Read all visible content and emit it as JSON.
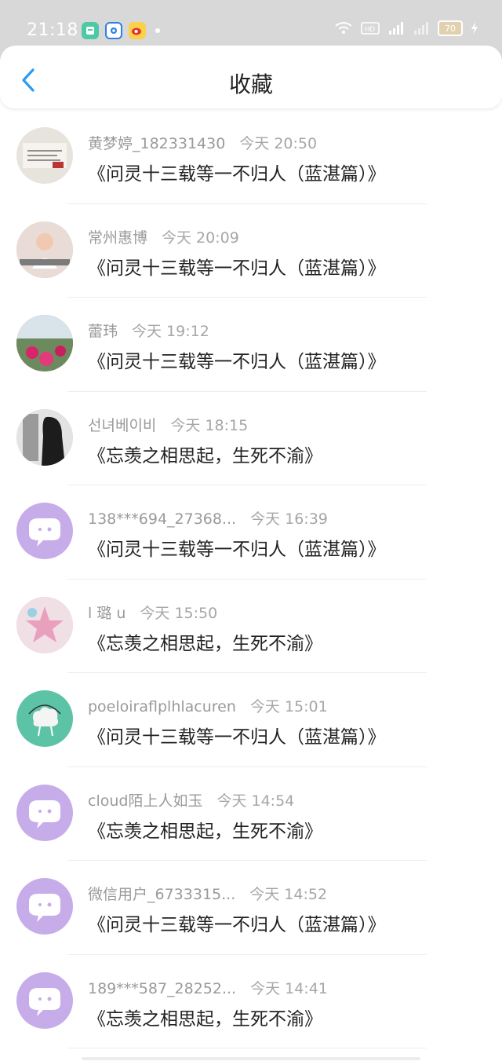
{
  "status_bar": {
    "time": "21:18",
    "icons": [
      "notification-app-icon",
      "browser-app-icon",
      "weibo-icon",
      "dot-icon"
    ],
    "right_icons": [
      "wifi-icon",
      "hd-icon",
      "4g-signal-icon",
      "signal-icon"
    ],
    "battery": "70"
  },
  "header": {
    "title": "收藏",
    "back_icon": "chevron-left-icon"
  },
  "list": [
    {
      "name": "黄梦婷_182331430",
      "time": "今天 20:50",
      "book": "《问灵十三载等一不归人（蓝湛篇）》",
      "avatar": "av-paper"
    },
    {
      "name": "常州惠博",
      "time": "今天 20:09",
      "book": "《问灵十三载等一不归人（蓝湛篇）》",
      "avatar": "av-baby"
    },
    {
      "name": "蕾玮",
      "time": "今天 19:12",
      "book": "《问灵十三载等一不归人（蓝湛篇）》",
      "avatar": "av-flowers"
    },
    {
      "name": "선녀베이비",
      "time": "今天 18:15",
      "book": "《忘羡之相思起，生死不渝》",
      "avatar": "av-girl"
    },
    {
      "name": "138***694_27368...",
      "time": "今天 16:39",
      "book": "《问灵十三载等一不归人（蓝湛篇）》",
      "avatar": "av-purple"
    },
    {
      "name": "l 璐 u",
      "time": "今天 15:50",
      "book": "《忘羡之相思起，生死不渝》",
      "avatar": "av-star"
    },
    {
      "name": "poeloiraflplhlacuren",
      "time": "今天 15:01",
      "book": "《问灵十三载等一不归人（蓝湛篇）》",
      "avatar": "av-cloud-green"
    },
    {
      "name": "cloud陌上人如玉",
      "time": "今天 14:54",
      "book": "《忘羡之相思起，生死不渝》",
      "avatar": "av-purple"
    },
    {
      "name": "微信用户_6733315...",
      "time": "今天 14:52",
      "book": "《问灵十三载等一不归人（蓝湛篇）》",
      "avatar": "av-purple"
    },
    {
      "name": "189***587_28252...",
      "time": "今天 14:41",
      "book": "《忘羡之相思起，生死不渝》",
      "avatar": "av-purple"
    }
  ],
  "colors": {
    "accent": "#2b9cf2",
    "status_bar_bg": "#d8d8d8",
    "avatar_purple": "#c7acea",
    "avatar_green": "#5dc3a7"
  }
}
